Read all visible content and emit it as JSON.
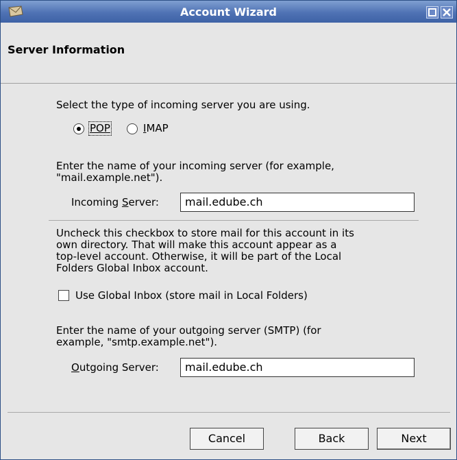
{
  "window": {
    "title": "Account Wizard",
    "icons": {
      "app": "mail-icon",
      "maximize": "maximize-icon",
      "close": "close-icon"
    }
  },
  "header": {
    "title": "Server Information"
  },
  "incoming": {
    "prompt_type": "Select the type of incoming server you are using.",
    "options": [
      {
        "label": "POP",
        "selected": true
      },
      {
        "label": "IMAP",
        "selected": false
      }
    ],
    "prompt_name_line1": "Enter the name of your incoming server (for example,",
    "prompt_name_line2": "\"mail.example.net\").",
    "field_label": "Incoming Server:",
    "field_value": "mail.edube.ch"
  },
  "global_inbox": {
    "explanation_lines": [
      "Uncheck this checkbox to store mail for this account in its",
      "own directory. That will make this account appear as a",
      "top-level account. Otherwise, it will be part of the Local",
      "Folders Global Inbox account."
    ],
    "checkbox_label": "Use Global Inbox (store mail in Local Folders)",
    "checked": false
  },
  "outgoing": {
    "prompt_line1": "Enter the name of your outgoing server (SMTP) (for",
    "prompt_line2": "example, \"smtp.example.net\").",
    "field_label": "Outgoing Server:",
    "field_value": "mail.edube.ch"
  },
  "buttons": {
    "cancel": "Cancel",
    "back": "Back",
    "next": "Next"
  },
  "colors": {
    "titlebar": "#4f72b4",
    "background": "#e6e6e6",
    "field_bg": "#ffffff"
  }
}
